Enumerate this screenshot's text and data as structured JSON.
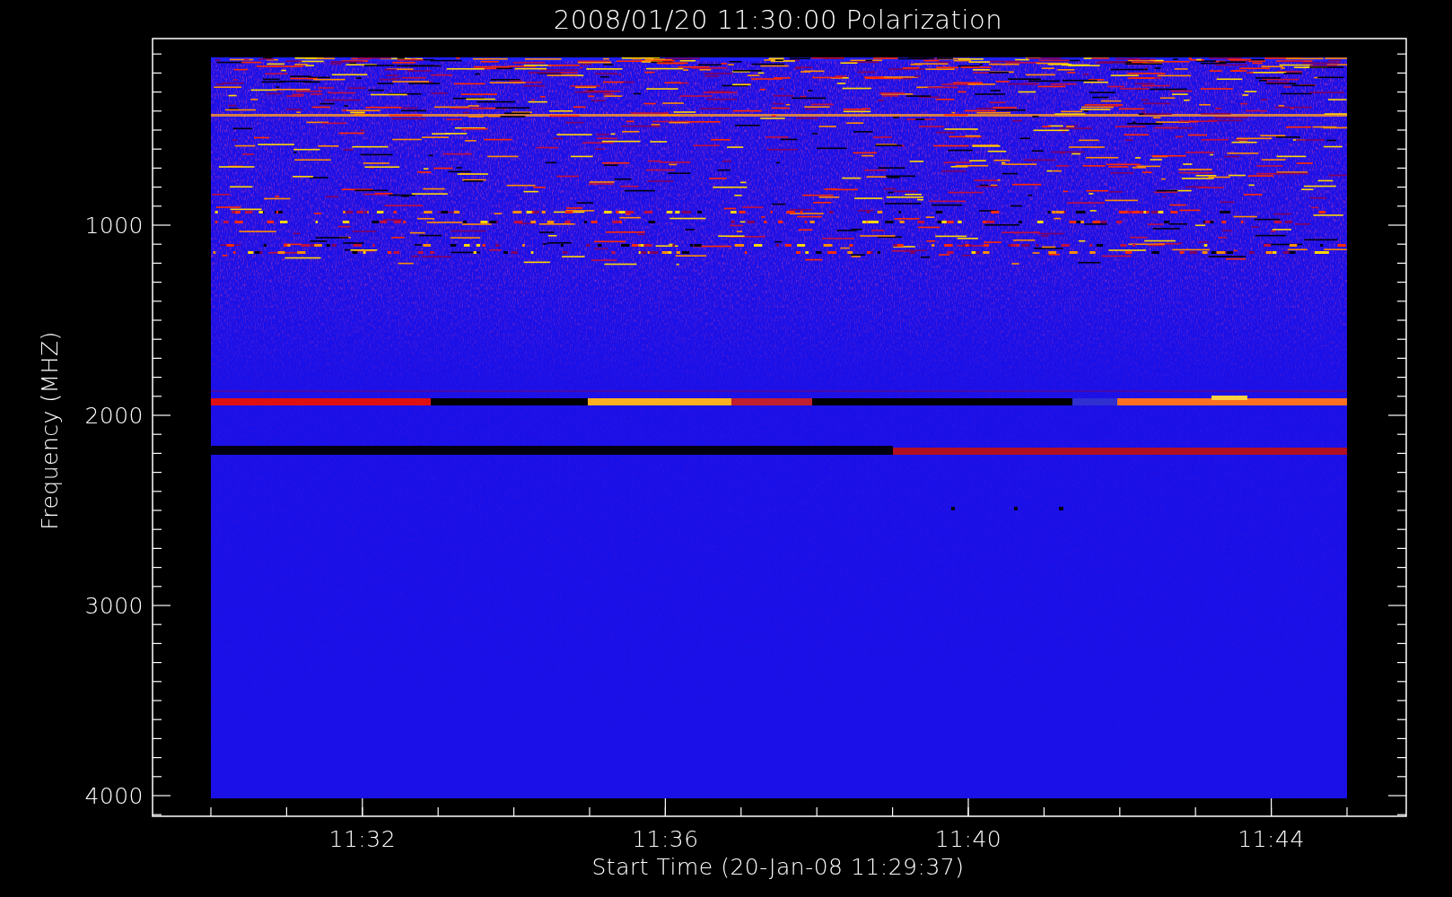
{
  "title": "2008/01/20 11:30:00 Polarization",
  "xlabel": "Start Time (20-Jan-08 11:29:37)",
  "ylabel": "Frequency (MHZ)",
  "yticks": [
    "1000",
    "2000",
    "3000",
    "4000"
  ],
  "xticks": [
    "11:32",
    "11:36",
    "11:40",
    "11:44"
  ]
}
